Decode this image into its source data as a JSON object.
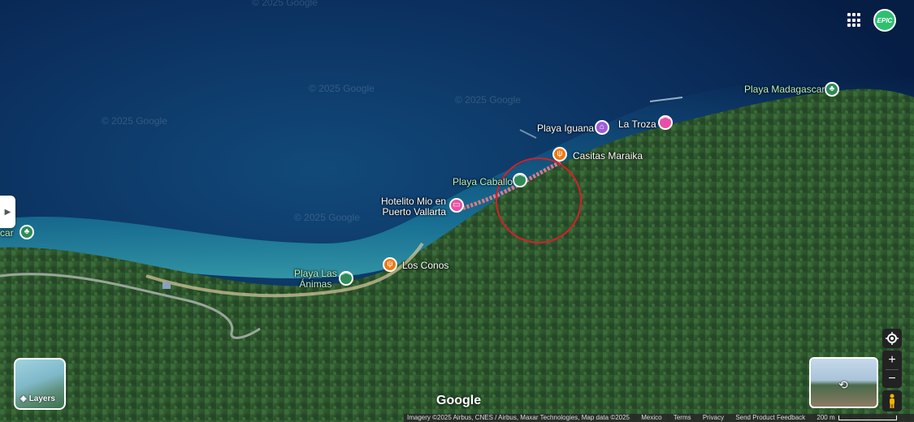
{
  "watermark": "© 2025 Google",
  "places": [
    {
      "id": "playa-madagascar",
      "name": "Playa Madagascar",
      "kind": "beach",
      "color": "green"
    },
    {
      "id": "playa-iguana",
      "name": "Playa Iguana",
      "kind": "hotel",
      "color": "purple"
    },
    {
      "id": "la-troza",
      "name": "La Troza",
      "kind": "beach",
      "color": "pink"
    },
    {
      "id": "casitas-maraika",
      "name": "Casitas Maraika",
      "kind": "restaurant",
      "color": "orange"
    },
    {
      "id": "playa-caballo",
      "name": "Playa Caballo",
      "kind": "beach",
      "color": "green"
    },
    {
      "id": "hotelito-mio",
      "name": "Hotelito Mio en\nPuerto Vallarta",
      "kind": "hotel",
      "color": "pink"
    },
    {
      "id": "los-conos",
      "name": "Los Conos",
      "kind": "restaurant",
      "color": "orange"
    },
    {
      "id": "playa-las-animas",
      "name": "Playa Las\nÁnimas",
      "kind": "beach",
      "color": "green"
    },
    {
      "id": "left-edge",
      "name": "car",
      "kind": "beach",
      "color": "green"
    }
  ],
  "controls": {
    "layers_label": "Layers",
    "zoom_in": "+",
    "zoom_out": "−",
    "avatar_text": "EPIC"
  },
  "branding": "Google",
  "footer": {
    "imagery": "Imagery ©2025 Airbus, CNES / Airbus, Maxar Technologies, Map data ©2025",
    "country": "Mexico",
    "terms": "Terms",
    "privacy": "Privacy",
    "feedback": "Send Product Feedback",
    "scale": "200 m"
  },
  "colors": {
    "ocean_deep": "#0a2a55",
    "ocean_shallow": "#1e7fa3",
    "forest": "#2f5a2e",
    "highlight_circle": "#d4202a",
    "trail": "#e07a80"
  }
}
